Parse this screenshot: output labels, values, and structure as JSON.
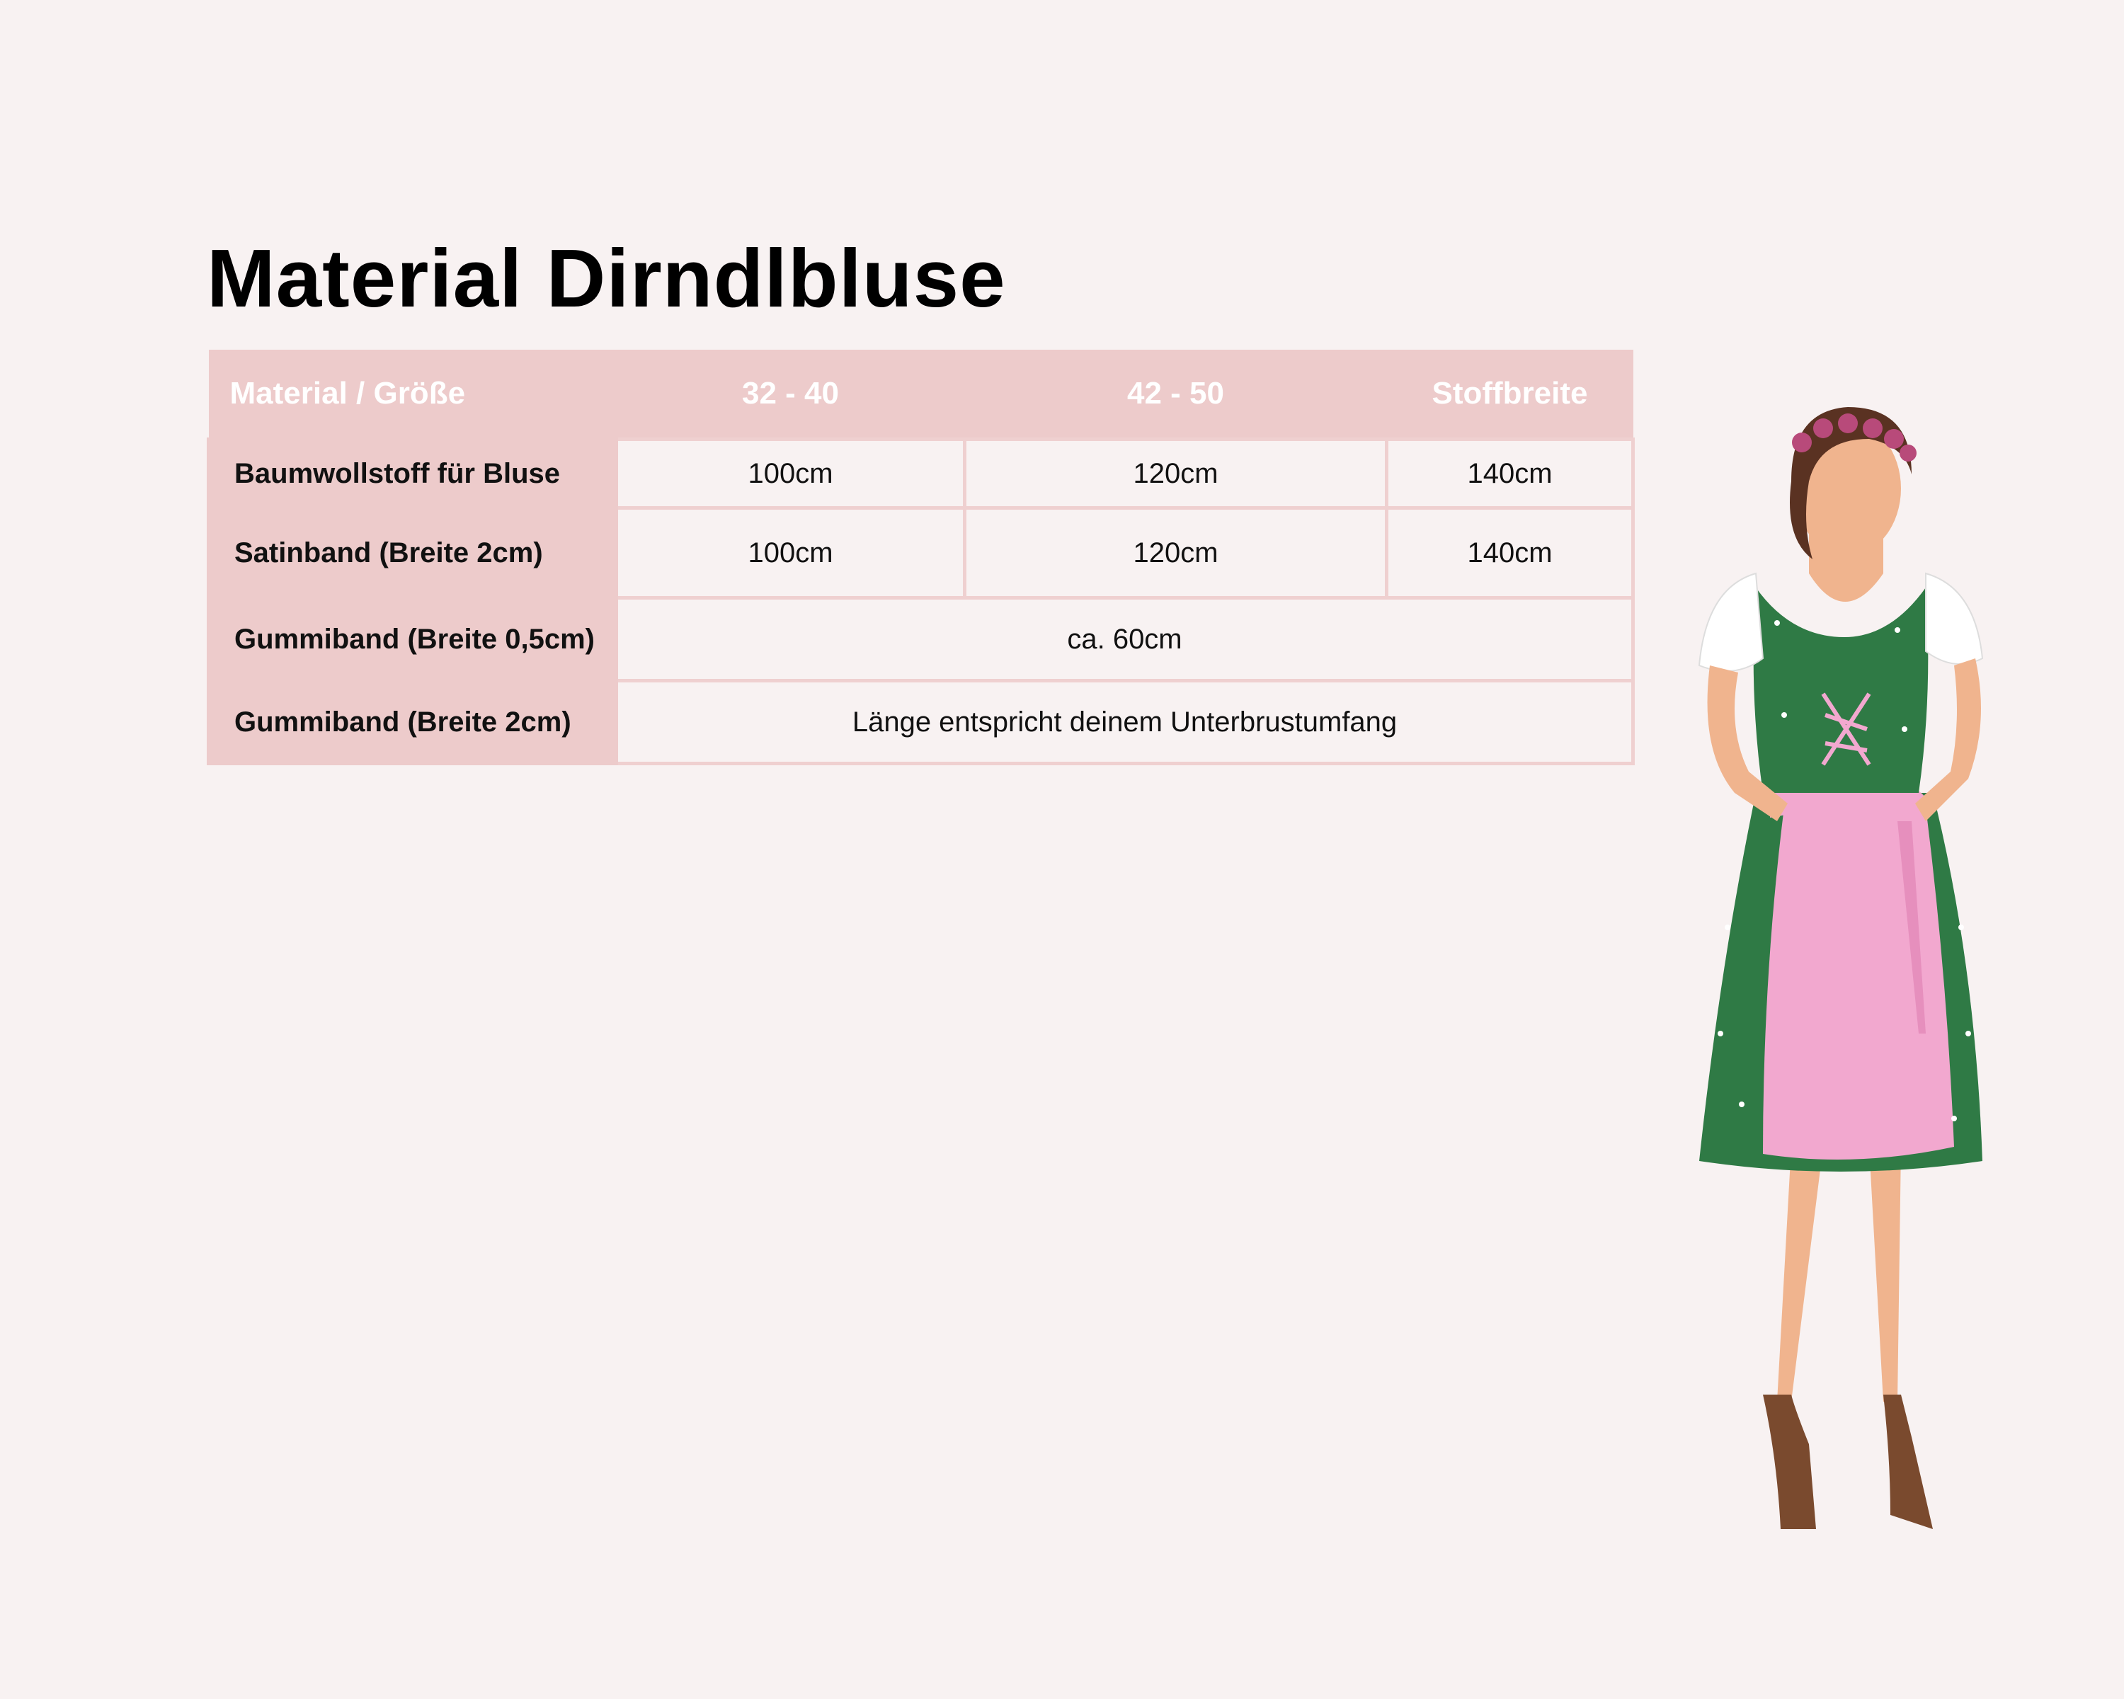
{
  "title": "Material Dirndlbluse",
  "table": {
    "headers": [
      "Material / Größe",
      "32 - 40",
      "42 - 50",
      "Stoffbreite"
    ],
    "rows": [
      {
        "label": "Baumwollstoff für Bluse",
        "cells": [
          "100cm",
          "120cm",
          "140cm"
        ]
      },
      {
        "label": "Satinband (Breite 2cm)",
        "cells": [
          "100cm",
          "120cm",
          "140cm"
        ]
      },
      {
        "label": "Gummiband (Breite 0,5cm)",
        "merged": "ca. 60cm"
      },
      {
        "label": "Gummiband (Breite 2cm)",
        "merged": "Länge entspricht deinem Unterbrustumfang"
      }
    ]
  },
  "illustration": {
    "icon": "woman-in-dirndl-illustration",
    "colors": {
      "dress": "#2f7a45",
      "apron": "#f2a8cf",
      "blouse": "#ffffff",
      "skin": "#f0b48e",
      "hair": "#5a3222"
    }
  },
  "colors": {
    "background": "#f8f2f2",
    "header_fill": "#edcbcb",
    "border": "#efd0d0"
  }
}
